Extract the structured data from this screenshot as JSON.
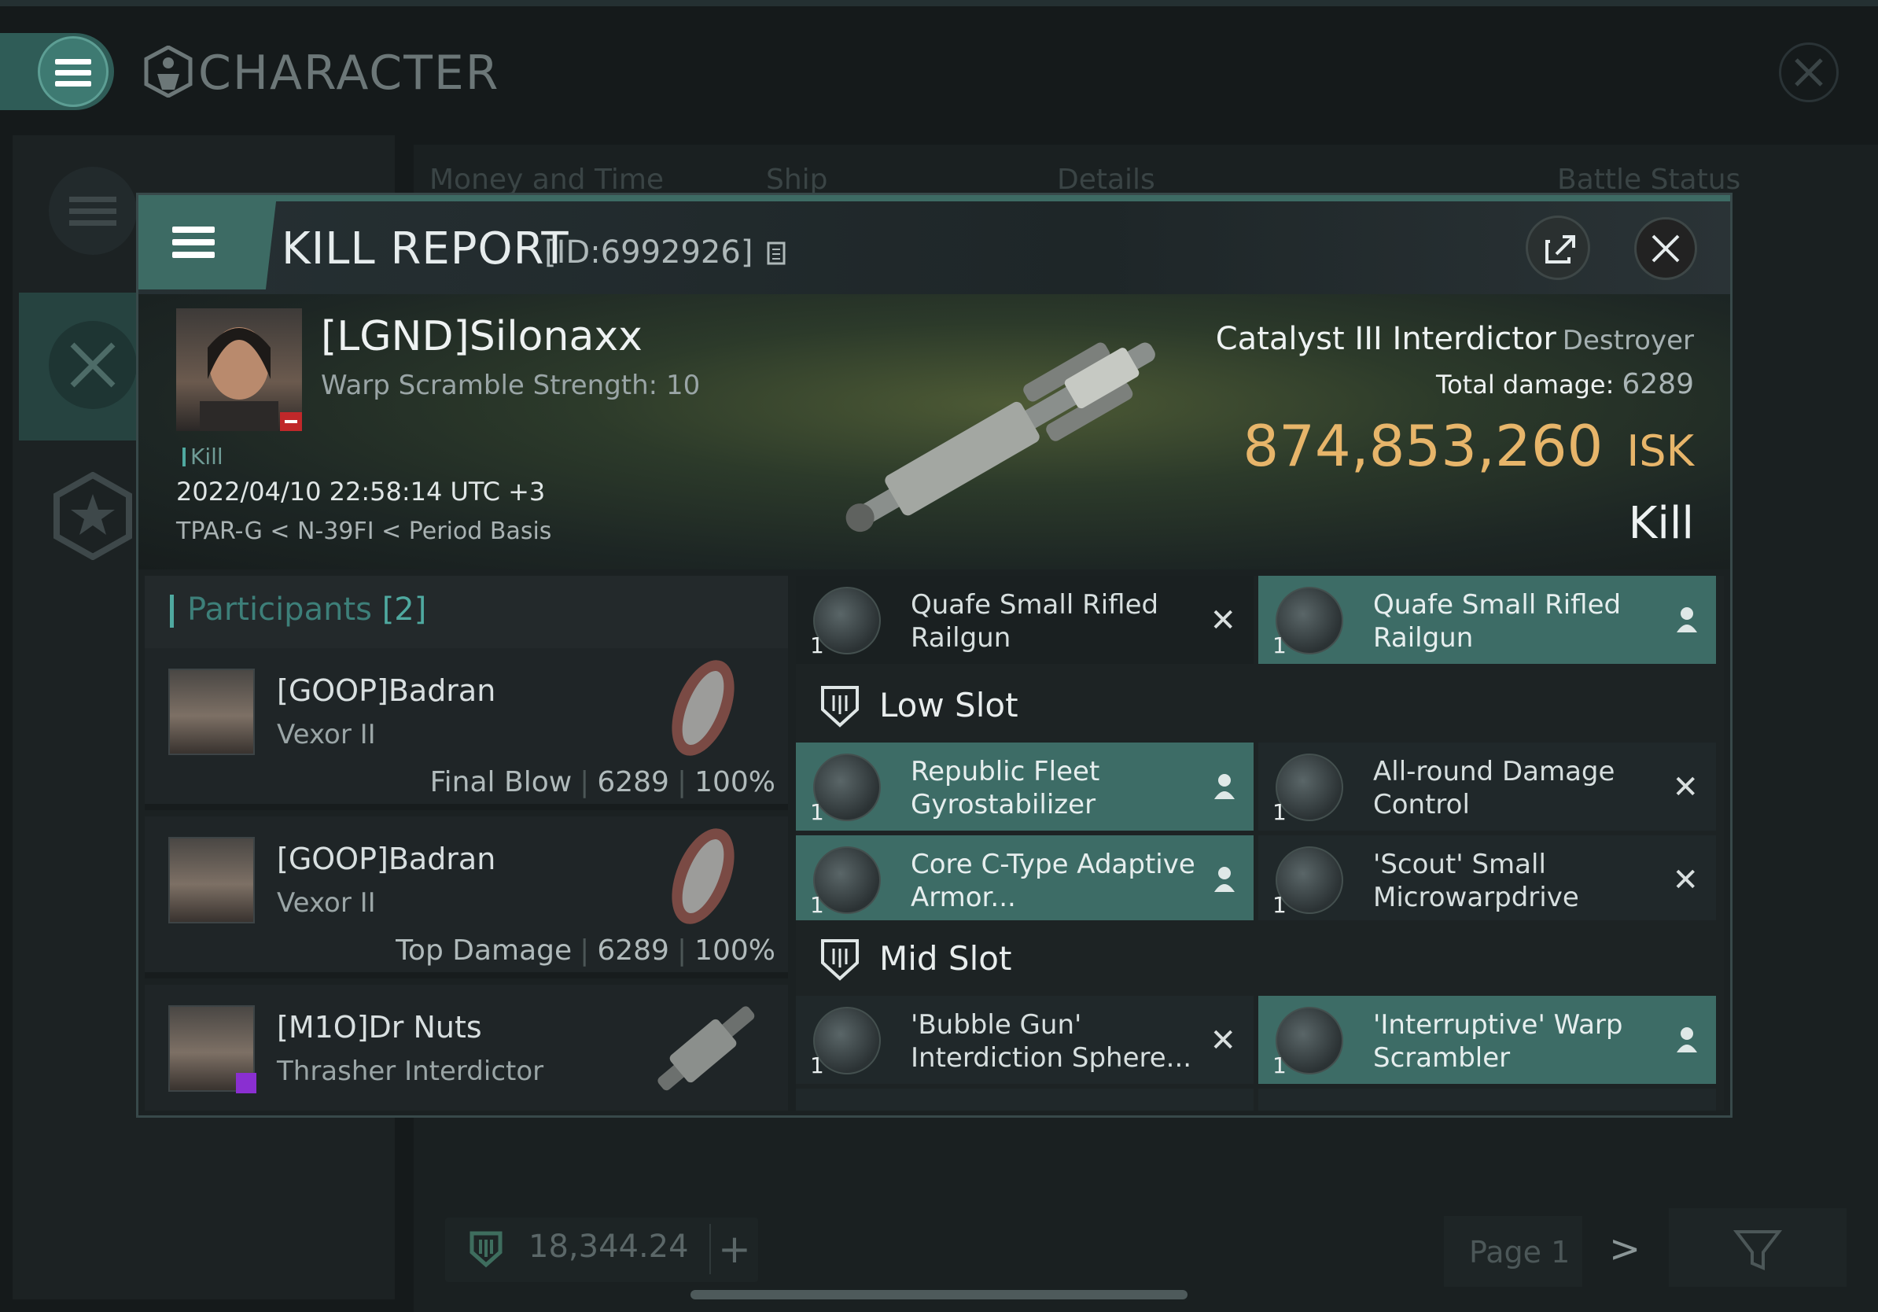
{
  "app": {
    "title": "CHARACTER",
    "bg_tabs": [
      "Money and Time",
      "Ship",
      "Details",
      "Battle Status"
    ],
    "bottom_value": "18,344.24",
    "page_label": "Page 1"
  },
  "kill_report": {
    "title": "KILL REPORT",
    "id": "[ID:6992926]",
    "victim": {
      "name": "[LGND]Silonaxx",
      "subtitle": "Warp Scramble Strength: 10",
      "tag": "Kill",
      "datetime": "2022/04/10 22:58:14 UTC +3",
      "location": "TPAR-G < N-39FI < Period Basis"
    },
    "ship": {
      "name": "Catalyst III Interdictor",
      "class": "Destroyer",
      "total_damage_label": "Total damage:",
      "total_damage": "6289",
      "isk_value": "874,853,260",
      "isk_unit": "ISK",
      "state": "Kill"
    },
    "participants": {
      "label": "Participants",
      "count": "[2]",
      "rows": [
        {
          "name": "[GOOP]Badran",
          "ship": "Vexor II",
          "stat_label": "Final Blow",
          "damage": "6289",
          "percent": "100%"
        },
        {
          "name": "[GOOP]Badran",
          "ship": "Vexor II",
          "stat_label": "Top Damage",
          "damage": "6289",
          "percent": "100%"
        },
        {
          "name": "[M1O]Dr Nuts",
          "ship": "Thrasher Interdictor"
        }
      ]
    },
    "fitting": {
      "top_row": [
        {
          "qty": "1",
          "name": "Quafe Small Rifled Railgun",
          "status": "destroyed"
        },
        {
          "qty": "1",
          "name": "Quafe Small Rifled Railgun",
          "status": "dropped"
        }
      ],
      "low_slot_label": "Low Slot",
      "low_slots": [
        {
          "qty": "1",
          "name": "Republic Fleet Gyrostabilizer",
          "status": "dropped"
        },
        {
          "qty": "1",
          "name": "All-round Damage Control",
          "status": "destroyed"
        },
        {
          "qty": "1",
          "name": "Core C-Type Adaptive Armor...",
          "status": "dropped"
        },
        {
          "qty": "1",
          "name": "'Scout' Small Microwarpdrive",
          "status": "destroyed"
        }
      ],
      "mid_slot_label": "Mid Slot",
      "mid_slots": [
        {
          "qty": "1",
          "name": "'Bubble Gun' Interdiction Sphere...",
          "status": "destroyed"
        },
        {
          "qty": "1",
          "name": "'Interruptive' Warp Scrambler",
          "status": "dropped"
        }
      ]
    }
  },
  "colors": {
    "accent_teal": "#3d6c66",
    "isk_gold": "#e7b56a",
    "participants_teal": "#4fa9a0"
  }
}
